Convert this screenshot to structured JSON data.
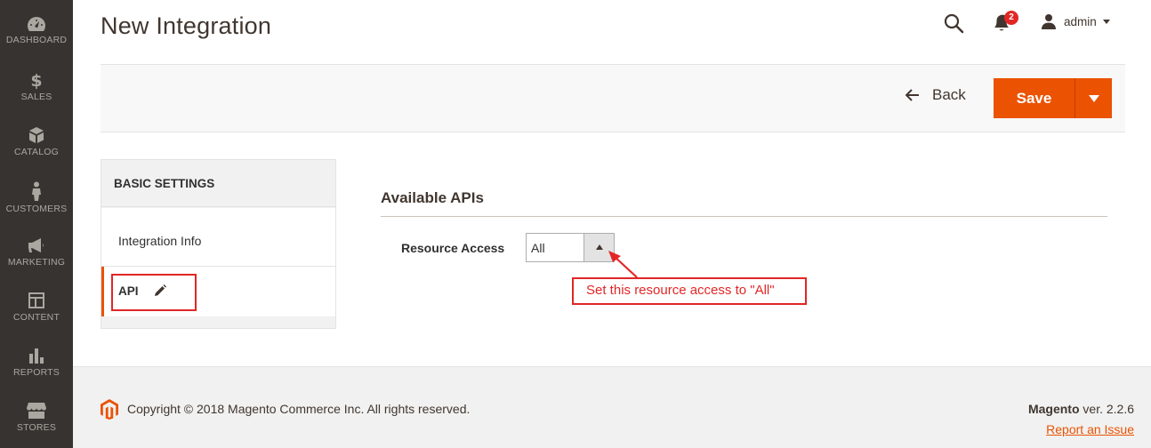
{
  "sidebar": {
    "items": [
      {
        "label": "DASHBOARD",
        "icon": "dashboard-icon"
      },
      {
        "label": "SALES",
        "icon": "dollar-icon"
      },
      {
        "label": "CATALOG",
        "icon": "box-icon"
      },
      {
        "label": "CUSTOMERS",
        "icon": "person-icon"
      },
      {
        "label": "MARKETING",
        "icon": "megaphone-icon"
      },
      {
        "label": "CONTENT",
        "icon": "layout-icon"
      },
      {
        "label": "REPORTS",
        "icon": "bar-chart-icon"
      },
      {
        "label": "STORES",
        "icon": "store-icon"
      }
    ]
  },
  "header": {
    "title": "New Integration",
    "notifications_count": "2",
    "username": "admin"
  },
  "actions": {
    "back_label": "Back",
    "save_label": "Save"
  },
  "tabs": {
    "heading": "BASIC SETTINGS",
    "integration_info": "Integration Info",
    "api": "API"
  },
  "main": {
    "section_title": "Available APIs",
    "resource_access_label": "Resource Access",
    "resource_access_value": "All",
    "annotation": "Set this resource access to \"All\""
  },
  "footer": {
    "copyright": "Copyright © 2018 Magento Commerce Inc. All rights reserved.",
    "brand": "Magento",
    "version": " ver. 2.2.6",
    "report_link": "Report an Issue"
  },
  "colors": {
    "sidebar_bg": "#373330",
    "accent": "#eb5202",
    "annotation_red": "#e22626"
  }
}
